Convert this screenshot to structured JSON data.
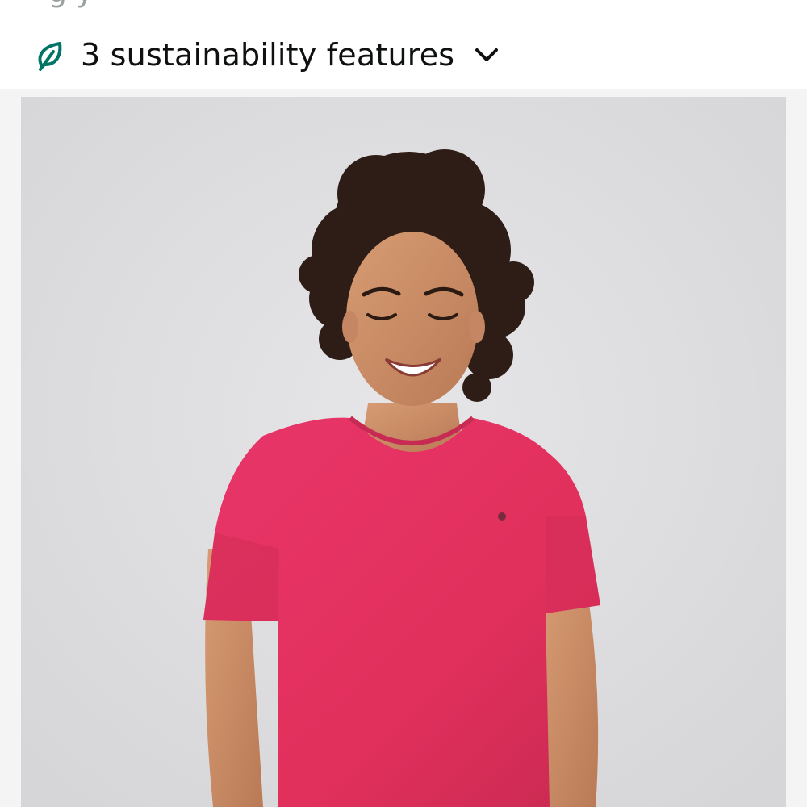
{
  "top_cut_text": "g y",
  "sustainability": {
    "label": "3 sustainability features",
    "leaf_icon": "leaf-icon",
    "chevron_icon": "chevron-down-icon",
    "leaf_color": "#007565"
  },
  "product_image": {
    "subject": "product-photo",
    "backdrop_color": "#dcdcde",
    "shirt_color": "#e53561"
  }
}
